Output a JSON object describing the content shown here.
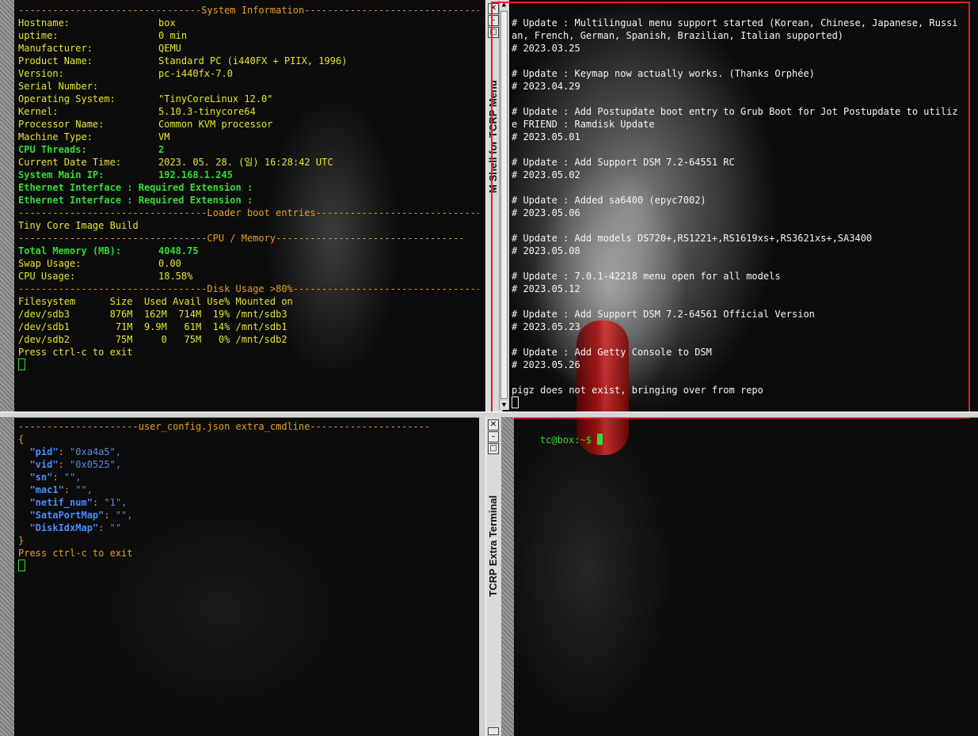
{
  "sysinfo": {
    "header": "--------------------------------System Information---------------------------------",
    "rows": [
      {
        "k": "Hostname:",
        "v": "box",
        "style": "y"
      },
      {
        "k": "uptime:",
        "v": "0 min",
        "style": "y"
      },
      {
        "k": "Manufacturer:",
        "v": "QEMU",
        "style": "y"
      },
      {
        "k": "Product Name:",
        "v": "Standard PC (i440FX + PIIX, 1996)",
        "style": "y"
      },
      {
        "k": "Version:",
        "v": "pc-i440fx-7.0",
        "style": "y"
      },
      {
        "k": "Serial Number:",
        "v": "",
        "style": "y"
      },
      {
        "k": "Operating System:",
        "v": "\"TinyCoreLinux 12.0\"",
        "style": "y"
      },
      {
        "k": "Kernel:",
        "v": "5.10.3-tinycore64",
        "style": "y"
      },
      {
        "k": "Processor Name:",
        "v": "Common KVM processor",
        "style": "y"
      },
      {
        "k": "Machine Type:",
        "v": "VM",
        "style": "y"
      },
      {
        "k": "CPU Threads:",
        "v": "2",
        "style": "g"
      },
      {
        "k": "Current Date Time:",
        "v": "2023. 05. 28. (일) 16:28:42 UTC",
        "style": "y"
      },
      {
        "k": "System Main IP:",
        "v": "192.168.1.245",
        "style": "g"
      }
    ],
    "eth_lines": [
      "Ethernet Interface : Required Extension :",
      "Ethernet Interface : Required Extension :"
    ],
    "loader_header": "---------------------------------Loader boot entries---------------------------------",
    "loader_entry": "Tiny Core Image Build",
    "cpu_header": "---------------------------------CPU / Memory---------------------------------",
    "mem_rows": [
      {
        "k": "Total Memory (MB):",
        "v": "4048.75",
        "style": "g"
      },
      {
        "k": "Swap Usage:",
        "v": "0.00",
        "style": "y"
      },
      {
        "k": "CPU Usage:",
        "v": "18.58%",
        "style": "y"
      }
    ],
    "disk_header": "---------------------------------Disk Usage >80%---------------------------------",
    "disk_table": [
      "Filesystem      Size  Used Avail Use% Mounted on",
      "/dev/sdb3       876M  162M  714M  19% /mnt/sdb3",
      "/dev/sdb1        71M  9.9M   61M  14% /mnt/sdb1",
      "/dev/sdb2        75M     0   75M   0% /mnt/sdb2"
    ],
    "exit_hint": "Press ctrl-c to exit"
  },
  "menu": {
    "title": "M Shell for TCRP Menu",
    "lines": [
      "",
      "# Update : Multilingual menu support started (Korean, Chinese, Japanese, Russi",
      "an, French, German, Spanish, Brazilian, Italian supported)",
      "# 2023.03.25",
      "",
      "# Update : Keymap now actually works. (Thanks Orphée)",
      "# 2023.04.29",
      "",
      "# Update : Add Postupdate boot entry to Grub Boot for Jot Postupdate to utiliz",
      "e FRIEND : Ramdisk Update",
      "# 2023.05.01",
      "",
      "# Update : Add Support DSM 7.2-64551 RC",
      "# 2023.05.02",
      "",
      "# Update : Added sa6400 (epyc7002)",
      "# 2023.05.06",
      "",
      "# Update : Add models DS720+,RS1221+,RS1619xs+,RS3621xs+,SA3400",
      "# 2023.05.08",
      "",
      "# Update : 7.0.1-42218 menu open for all models",
      "# 2023.05.12",
      "",
      "# Update : Add Support DSM 7.2-64561 Official Version",
      "# 2023.05.23",
      "",
      "# Update : Add Getty Console to DSM",
      "# 2023.05.26",
      "",
      "pigz does not exist, bringing over from repo"
    ]
  },
  "config": {
    "header": "---------------------user_config.json extra_cmdline---------------------",
    "open": "{",
    "entries": [
      {
        "k": "\"pid\"",
        "v": "\"0xa4a5\","
      },
      {
        "k": "\"vid\"",
        "v": "\"0x0525\","
      },
      {
        "k": "\"sn\"",
        "v": "\"\","
      },
      {
        "k": "\"mac1\"",
        "v": "\"\","
      },
      {
        "k": "\"netif_num\"",
        "v": "\"1\","
      },
      {
        "k": "\"SataPortMap\"",
        "v": "\"\","
      },
      {
        "k": "\"DiskIdxMap\"",
        "v": "\"\""
      }
    ],
    "close": "}",
    "exit_hint": "Press ctrl-c to exit"
  },
  "extra": {
    "title": "TCRP Extra Terminal",
    "prompt": "tc@box:~$ "
  }
}
